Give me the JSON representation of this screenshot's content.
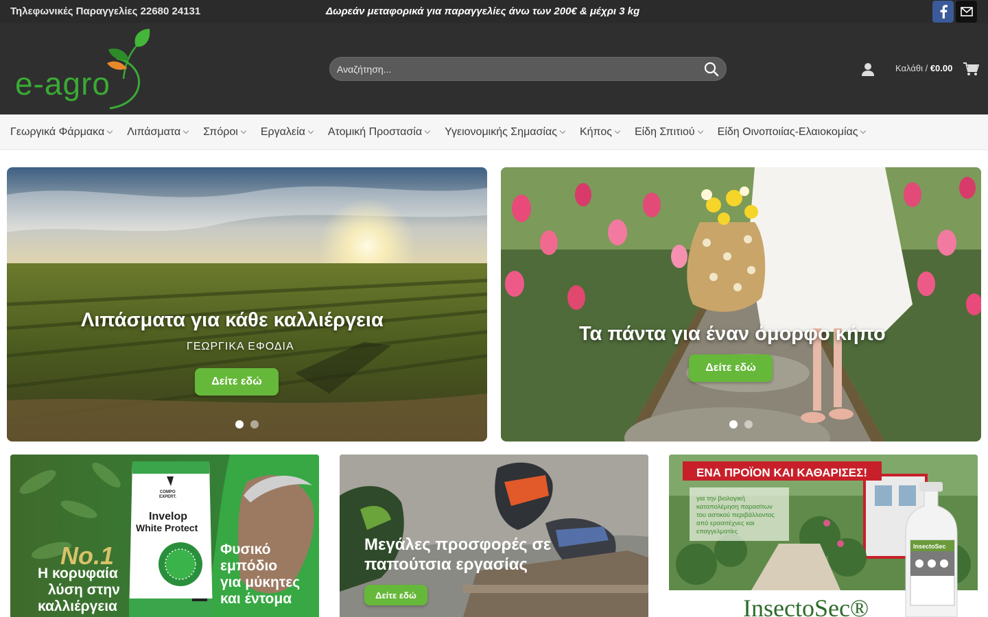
{
  "topbar": {
    "phone": "Τηλεφωνικές Παραγγελίες 22680 24131",
    "promo": "Δωρεάν μεταφορικά για παραγγελίες άνω των 200€ & μέχρι 3 kg",
    "social": [
      "facebook-icon",
      "mail-icon"
    ]
  },
  "header": {
    "logo_text": "e-agro",
    "search_placeholder": "Αναζήτηση...",
    "cart_label": "Καλάθι /",
    "cart_total": "€0.00"
  },
  "nav": {
    "items": [
      {
        "label": "Γεωργικά Φάρμακα"
      },
      {
        "label": "Λιπάσματα"
      },
      {
        "label": "Σπόροι"
      },
      {
        "label": "Εργαλεία"
      },
      {
        "label": "Ατομική Προστασία"
      },
      {
        "label": "Υγειονομικής Σημασίας"
      },
      {
        "label": "Κήπος"
      },
      {
        "label": "Είδη Σπιτιού"
      },
      {
        "label": "Είδη Οινοποιίας-Ελαιοκομίας"
      }
    ]
  },
  "hero": [
    {
      "title": "Λιπάσματα για κάθε καλλιέργεια",
      "subtitle": "ΓΕΩΡΓΙΚΑ ΕΦΟΔΙΑ",
      "button": "Δείτε εδώ",
      "slide_count": 2,
      "active_slide": 1
    },
    {
      "title": "Τα πάντα για έναν όμορφο κήπο",
      "button": "Δείτε εδώ",
      "slide_count": 2,
      "active_slide": 1
    }
  ],
  "banners": [
    {
      "brand": "COMPO EXPERT.",
      "product_line1": "Invelop",
      "product_line2": "White Protect",
      "badge": "No.1",
      "left_text": [
        "Η κορυφαία",
        "λύση στην",
        "καλλιέργεια"
      ],
      "right_text": [
        "Φυσικό",
        "εμπόδιο",
        "για μύκητες",
        "και έντομα"
      ]
    },
    {
      "title_line1": "Μεγάλες προσφορές σε",
      "title_line2": "παπούτσια εργασίας",
      "button": "Δείτε εδώ"
    },
    {
      "headline": "ΕΝΑ ΠΡΟΪΟΝ ΚΑΙ ΚΑΘΑΡΙΣΕΣ!",
      "desc": [
        "για την βιολογική",
        "καταπολέμηση παρασίτων",
        "του αστικού περιβάλλοντος",
        "από ερασιτέχνες και",
        "επαγγελματίες"
      ],
      "brand": "InsectoSec®",
      "bottle_label": "InsectoSec"
    }
  ],
  "colors": {
    "accent_green": "#66b83a",
    "topbar": "#2b2b2b",
    "header": "#2f2f2f",
    "banner_red": "#c8202a"
  }
}
